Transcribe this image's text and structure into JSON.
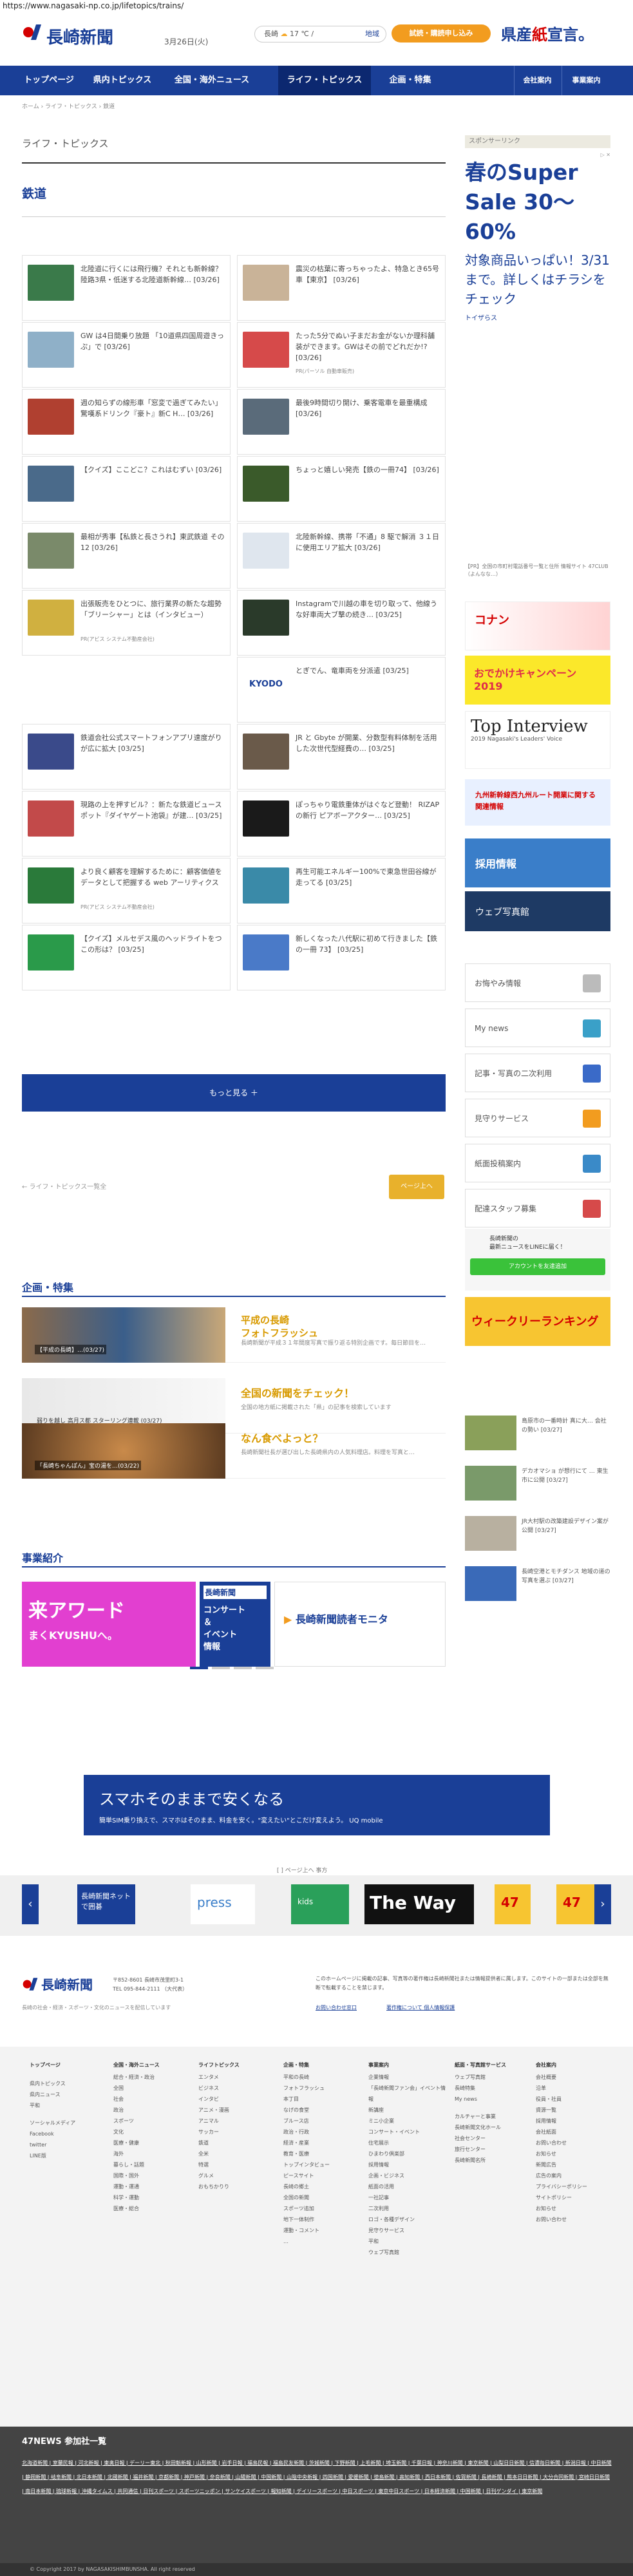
{
  "url": "https://www.nagasaki-np.co.jp/lifetopics/trains/",
  "header": {
    "logo": "長崎新聞",
    "date": "3月26日(火)",
    "weather": {
      "city": "長崎",
      "temp": "17 ℃",
      "sep": "/",
      "reg_label": "地域"
    },
    "trial_button": "試読・購読申し込み",
    "ken_text": "県産",
    "ken_red": "紙",
    "ken_tail": "宣言。"
  },
  "nav": {
    "items": [
      "トップページ",
      "県内トピックス",
      "全国・海外ニュース",
      "ライフ・トピックス",
      "企画・特集"
    ],
    "right": [
      "会社案内",
      "事業案内"
    ]
  },
  "breadcrumb": "ホーム › ライフ・トピックス › 鉄道",
  "section_title": "ライフ・トピックス",
  "sub_title": "鉄道",
  "articles": [
    {
      "text": "北陸道に行くには飛行機？それとも新幹線？陸路3県・低迷する北陸道新幹線… [03/26]",
      "pr": ""
    },
    {
      "text": "震災の枯葉に寄っちゃったよ、特急とき65号車【東京】 [03/26]",
      "pr": ""
    },
    {
      "text": "GW は4日間乗り放題 「10道県四国周遊きっぷ」で [03/26]",
      "pr": ""
    },
    {
      "text": "たった5分でぬい子まだお金がないか理科舗装ができます。GWはその前でどれだか!? [03/26]",
      "pr": "PR(パーソル 自動車販売)"
    },
    {
      "text": "週の知らずの線形車「窓変で過ぎてみたい」 驚嘆系ドリンク『豪ト』新C H… [03/26]",
      "pr": ""
    },
    {
      "text": "最後9時間切り開け、乗客電車を最重構成 [03/26]",
      "pr": ""
    },
    {
      "text": "【クイズ】ここどこ？これはむずい [03/26]",
      "pr": ""
    },
    {
      "text": "ちょっと嬉しい発売【鉄の一冊74】 [03/26]",
      "pr": ""
    },
    {
      "text": "最相が秀事【私鉄と長さうれ】東武鉄道 その12 [03/26]",
      "pr": ""
    },
    {
      "text": "北陸新幹線、携帯「不通」8 駆で解消 ３１日に使用エリア拡大 [03/26]",
      "pr": ""
    },
    {
      "text": "出張販売をひとつに、旅行業界の新たな趨勢「ブリーシャー」とは（インタビュー）",
      "pr": "PR(アビス システム不動産会社)"
    },
    {
      "text": "Instagramで川越の車を切り取って、他線うな好車両大ブ撃の続き… [03/25]",
      "pr": ""
    },
    {
      "text": "",
      "pr": ""
    },
    {
      "text": "とぎでん、竜車両を分派遣 [03/25]",
      "pr": ""
    },
    {
      "text": "鉄道会社公式スマートフォンアプリ速度がりが広に拡大 [03/25]",
      "pr": ""
    },
    {
      "text": "JR と Gbyte が開業、分数型有料体制を活用した次世代型経費の… [03/25]",
      "pr": ""
    },
    {
      "text": "現路の上を押すビル？：新たな鉄道ビュースポット『ダイヤゲート池袋』が建… [03/25]",
      "pr": ""
    },
    {
      "text": "ぽっちゃり電鉄重体がはぐなど登動！ RIZAP の新行 ピアボーアクター… [03/25]",
      "pr": ""
    },
    {
      "text": "より良く顧客を理解するために：顧客価値をデータとして把握する web アーリティクス",
      "pr": "PR(アビス システム不動産会社)"
    },
    {
      "text": "再生可能エネルギー100%で東急世田谷線が走ってる [03/25]",
      "pr": ""
    },
    {
      "text": "【クイズ】メルセデス風のヘッドライトをつこの形は？ [03/25]",
      "pr": ""
    },
    {
      "text": "新しくなった八代駅に初めて行きました【鉄の一冊 73】 [03/25]",
      "pr": ""
    }
  ],
  "more_button": "もっと見る ＋",
  "pager": {
    "prev": "← ライフ・トピックス一覧全",
    "top": "ページ上へ"
  },
  "kikaku": {
    "title": "企画・特集",
    "items": [
      {
        "title": "平成の長崎\nフォトフラッシュ",
        "desc": "長崎新聞が平成３１年間度写真で振り返る特別企画です。毎日節目を…",
        "cap": "【平成の長崎】…(03/27)"
      },
      {
        "title": "全国の新聞をチェック！",
        "desc": "全国の地方紙に掲載された「県」の記事を検索しています",
        "cap": "弱りを越し 高月ス都 スターリング連載 (03/27)"
      },
      {
        "title": "なん食べよっと？",
        "desc": "長崎新聞社長が選び出した長崎県内の人気料理店。料理を写真と…",
        "cap": "「長崎ちゃんぽん」宝の湯を…(03/22)"
      }
    ]
  },
  "jigyo": {
    "title": "事業紹介",
    "banner_left": "来アワード",
    "banner_left2": "まくKYUSHUへ。",
    "banner_mid1": "長崎新聞",
    "banner_mid2": "コンサート\n＆\nイベント\n情報",
    "banner_right": "長崎新聞読者モニタ"
  },
  "side": {
    "sponsor_label": "スポンサーリンク",
    "ad_title": "春のSuper Sale 30〜60%",
    "ad_sub": "対象商品いっぱい！3/31まで。詳しくはチラシをチェック",
    "ad_src": "トイザらス",
    "pr_text": "【PR】全国の市町村電話番号一覧と住所 情報サイト 47CLUB（よんなな…）",
    "ad_kohaku": "コナン",
    "ad_odeka": "おでかけキャンペーン2019",
    "ad_top_title": "Top Interview",
    "ad_top_sub": "2019 Nagasaki's Leaders' Voice",
    "ad_kyushu": "九州新幹線西九州ルート開業に関する関連情報",
    "ad_saiyo": "採用情報",
    "ad_web": "ウェブ写真館",
    "services": [
      "お悔やみ情報",
      "My news",
      "記事・写真の二次利用",
      "見守りサービス",
      "紙面投稿案内",
      "配達スタッフ募集"
    ],
    "line_text": "長崎新聞の\n最新ニュースをLINEに届く！",
    "line_btn": "アカウントを友達追加",
    "weekly": "ウィークリーランキング",
    "news": [
      "島原市の一番時計 真に大… 会社の勢い [03/27]",
      "デカオマショ が想行にて … 東生市に公開 [03/27]",
      "JR大村駅の改築建設デザイン案が公開 [03/27]",
      "長崎空港とモチダンス 地域の道の写真を選ぶ [03/27]"
    ]
  },
  "bottom_ad": {
    "line1": "スマホそのままで安くなる",
    "line2": "簡単SIM乗り換えで、スマホはそのまま、料金を安く。\"変えたい\"とこだけ変えよう。 UQ mobile"
  },
  "pr_label": "[ ] ページ上へ 事方",
  "carousel": [
    "長崎新聞ネットで囲碁",
    "press",
    "kids",
    "The Way",
    "47",
    "47"
  ],
  "footer": {
    "logo": "長崎新聞",
    "addr1": "〒852-8601 長崎市茂里町3-1",
    "addr2": "TEL 095-844-2111 （大代表）",
    "note": "長崎の社会・経済・スポーツ・文化のニュースを配信しています",
    "right": "このホームページに掲載の記事、写真等の著作権は長崎新聞社または情報提供者に属します。このサイトの一部または全部を無断で転載することを禁じます。",
    "link1": "お問い合わせ窓口",
    "link2": "著作権について 個人情報保護"
  },
  "sitemap": [
    {
      "h": "トップページ",
      "items": [
        "",
        "県内トピックス",
        "県内ニュース",
        "平和",
        "",
        "ソーシャルメディア",
        "Facebook",
        "twitter",
        "LINE版"
      ]
    },
    {
      "h": "全国・海外ニュース",
      "items": [
        "総合・経済・政治",
        "全国",
        "社会",
        "政治",
        "スポーツ",
        "文化",
        "医療・健康",
        "海外",
        "暮らし・話題",
        "国際・国外",
        "運動・運通",
        "科学・運動",
        "医療・総合"
      ]
    },
    {
      "h": "ライフトピックス",
      "items": [
        "エンタメ",
        "ビジネス",
        "インタビ",
        "アニメ・漫画",
        "アニマル",
        "サッカー",
        "鉄道",
        "全米",
        "特選",
        "グルメ",
        "おもちかりり"
      ]
    },
    {
      "h": "企画・特集",
      "items": [
        "平和の長崎",
        "フォトフラッシュ",
        "本丁目",
        "なげの食堂",
        "ブルース店",
        "政治・行政",
        "経済・産業",
        "教育・医療",
        "トップインタビュー",
        "ピースサイト",
        "長崎の郷土",
        "全国の新聞",
        "スポーツ追加",
        "地下一体制作",
        "運動・コメント",
        "…"
      ]
    },
    {
      "h": "事業案内",
      "items": [
        "企業情報",
        "「長崎新聞ファン会」イベント情報",
        "新講座",
        "ミニ小企業",
        "コンサート・イベント",
        "住宅展示",
        "ひまわり倶楽部",
        "採用情報",
        "企画・ビジネス",
        "紙面の活用",
        "一社記事",
        "二次利用",
        "ロゴ・各種デザイン",
        "見守りサービス",
        "平和",
        "ウェブ写真館"
      ]
    },
    {
      "h": "紙面・写真館サービス",
      "items": [
        "ウェブ写真館",
        "長崎特集",
        "My news",
        "",
        "カルチャーと事業",
        "長崎新聞文化ホール",
        "社会センター",
        "旅行センター",
        "長崎新聞名所"
      ]
    },
    {
      "h": "会社案内",
      "items": [
        "会社概要",
        "沿革",
        "役員・社員",
        "資源一覧",
        "採用情報",
        "会社紙面",
        "お問い合わせ",
        "お知らせ",
        "新聞広告",
        "広告の案内",
        "プライバシーポリシー",
        "サイトポリシー",
        "お知らせ",
        "お問い合わせ"
      ]
    }
  ],
  "n47": {
    "title": "47NEWS 参加社一覧",
    "list": "北海道新聞 | 室蘭民報 | 河北新報 | 東奥日報 | デーリー東北 | 秋田魁新報 | 山形新聞 | 岩手日報 | 福島民報 | 福島民友新聞 | 茨城新聞 | 下野新聞 | 上毛新聞 | 埼玉新聞 | 千葉日報 | 神奈川新聞 | 東京新聞 | 山梨日日新聞 | 信濃毎日新聞 | 新潟日報 | 中日新聞 | 静岡新聞 | 岐阜新聞 | 北日本新聞 | 北國新聞 | 福井新聞 | 京都新聞 | 神戸新聞 | 奈良新聞 | 山陽新聞 | 中国新聞 | 山陰中央新報 | 四国新聞 | 愛媛新聞 | 徳島新聞 | 高知新聞 | 西日本新聞 | 佐賀新聞 | 長崎新聞 | 熊本日日新聞 | 大分合同新聞 | 宮崎日日新聞 | 南日本新聞 | 琉球新報 | 沖縄タイムス | 共同通信 | 日刊スポーツ | スポーツニッポン | サンケイスポーツ | 報知新聞 | デイリースポーツ | 中日スポーツ | 東京中日スポーツ | 日本経済新聞 | 中国新聞 | 日刊ゲンダイ | 東京新聞"
  },
  "copyright": "© Copyright 2017 by NAGASAKISHIMBUNSHA. All right reserved"
}
